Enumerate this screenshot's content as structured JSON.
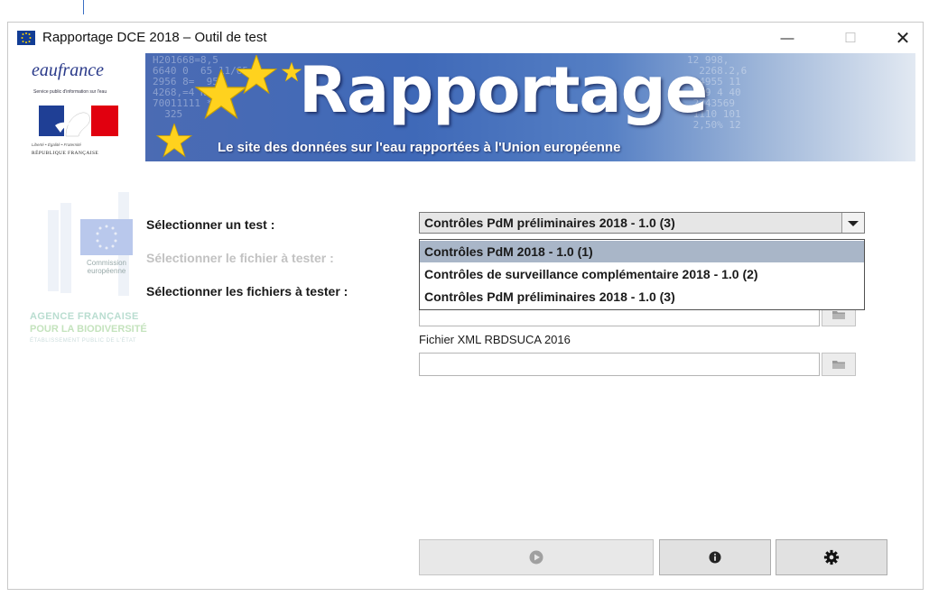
{
  "window": {
    "title": "Rapportage DCE 2018 – Outil de test",
    "controls": {
      "minimize": "—",
      "maximize": "☐",
      "close": "✕"
    }
  },
  "logos": {
    "eaufrance": "eaufrance",
    "eaufrance_tagline": "Service public d'information sur l'eau",
    "republique_devise": "Liberté • Égalité • Fraternité",
    "republique": "RÉPUBLIQUE FRANÇAISE",
    "commission": "Commission européenne",
    "afb_line1": "AGENCE FRANÇAISE",
    "afb_line2": "POUR LA BIODIVERSITÉ",
    "afb_line3": "ÉTABLISSEMENT PUBLIC DE L'ÉTAT"
  },
  "banner": {
    "title": "Rapportage",
    "subtitle": "Le site des données sur l'eau rapportées à l'Union européenne"
  },
  "form": {
    "select_test_label": "Sélectionner un test :",
    "select_file_label": "Sélectionner le fichier à tester :",
    "select_files_label": "Sélectionner les fichiers à tester :",
    "test_select": {
      "selected": "Contrôles PdM préliminaires 2018 - 1.0 (3)",
      "open": true,
      "highlighted_index": 0,
      "options": [
        "Contrôles PdM 2018 - 1.0 (1)",
        "Contrôles de surveillance complémentaire 2018 - 1.0 (2)",
        "Contrôles PdM préliminaires 2018 - 1.0 (3)"
      ]
    },
    "files": [
      {
        "label": "",
        "value": ""
      },
      {
        "label": "Fichier XML RBDSUCA 2016",
        "value": ""
      }
    ]
  },
  "actions": {
    "run": {
      "icon": "play-circle-icon",
      "enabled": false
    },
    "info": {
      "icon": "info-circle-icon",
      "enabled": true
    },
    "settings": {
      "icon": "gear-icon",
      "enabled": true
    }
  },
  "colors": {
    "banner_blue": "#3f69b8",
    "dropdown_highlight": "#a9b6c8",
    "disabled_text": "#c2c2c2"
  }
}
